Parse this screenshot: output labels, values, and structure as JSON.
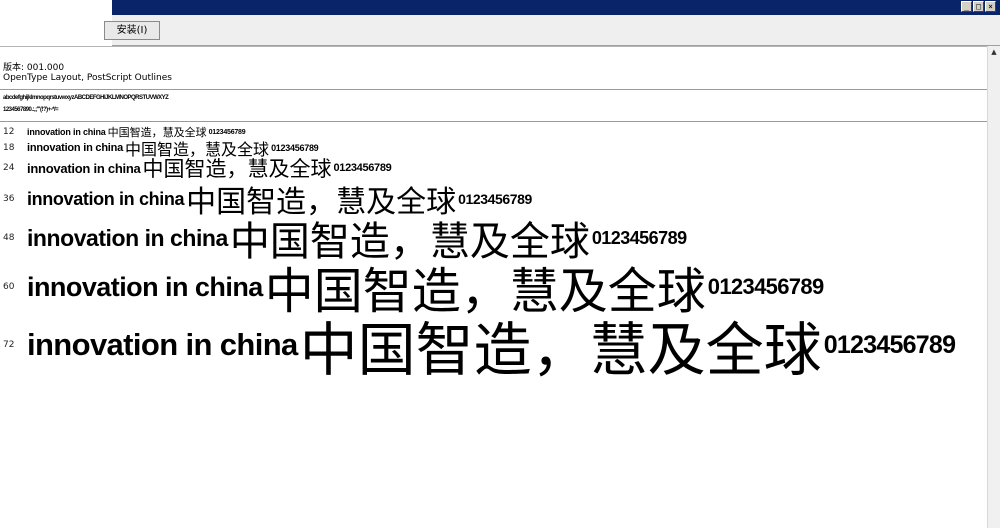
{
  "window": {
    "minimize": "_",
    "maximize": "□",
    "close": "×"
  },
  "toolbar": {
    "install_label": "安装(I)"
  },
  "info": {
    "version": "版本: 001.000",
    "format": "OpenType Layout, PostScript Outlines"
  },
  "charset": {
    "line1": "abcdefghijklmnopqrstuvwxyzABCDEFGHIJKLMNOPQRSTUVWXYZ",
    "line2": "1234567890.:,;'\"(!?)+-*/="
  },
  "samples": [
    {
      "size": "12",
      "latin": "innovation in china",
      "cjk": "中国智造，慧及全球",
      "digits": "0123456789"
    },
    {
      "size": "18",
      "latin": "innovation in china",
      "cjk": "中国智造，慧及全球",
      "digits": "0123456789"
    },
    {
      "size": "24",
      "latin": "innovation in china",
      "cjk": "中国智造，慧及全球",
      "digits": "0123456789"
    },
    {
      "size": "36",
      "latin": "innovation in china",
      "cjk": "中国智造，慧及全球",
      "digits": "0123456789"
    },
    {
      "size": "48",
      "latin": "innovation in china",
      "cjk": "中国智造，慧及全球",
      "digits": "0123456789"
    },
    {
      "size": "60",
      "latin": "innovation in china",
      "cjk": "中国智造，慧及全球",
      "digits": "0123456789"
    },
    {
      "size": "72",
      "latin": "innovation in china",
      "cjk": "中国智造，慧及全球",
      "digits": "0123456789"
    }
  ]
}
